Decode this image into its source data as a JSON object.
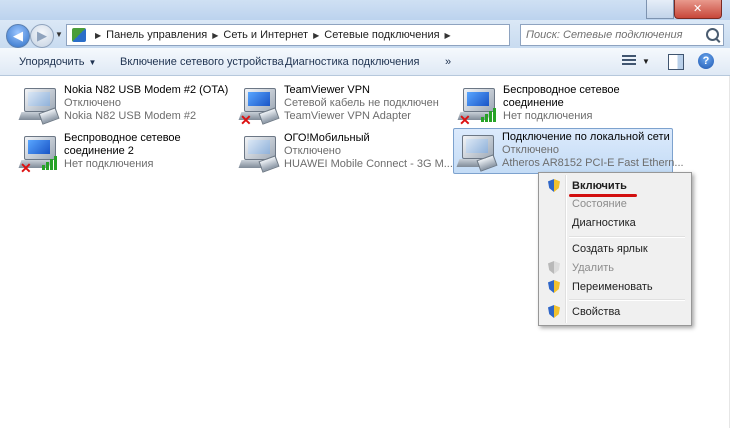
{
  "address": {
    "breadcrumbs": [
      "Панель управления",
      "Сеть и Интернет",
      "Сетевые подключения"
    ],
    "search_placeholder": "Поиск: Сетевые подключения"
  },
  "toolbar": {
    "organize": "Упорядочить",
    "enable_device": "Включение сетевого устройства",
    "diagnose": "Диагностика подключения",
    "more": "»"
  },
  "connections": [
    {
      "name": "Nokia N82 USB Modem #2 (OTA)",
      "status": "Отключено",
      "device": "Nokia N82 USB Modem #2",
      "icon": "modem-icon"
    },
    {
      "name": "TeamViewer VPN",
      "status": "Сетевой кабель не подключен",
      "device": "TeamViewer VPN Adapter",
      "icon": "network-cable-icon"
    },
    {
      "name": "Беспроводное сетевое",
      "name2": "соединение",
      "status": "Нет подключения",
      "icon": "wireless-icon"
    },
    {
      "name": "Беспроводное сетевое",
      "name2": "соединение 2",
      "status": "Нет подключения",
      "icon": "wireless-icon"
    },
    {
      "name": "ОГО!Мобильный",
      "status": "Отключено",
      "device": "HUAWEI Mobile Connect - 3G M...",
      "icon": "modem-icon"
    },
    {
      "name": "Подключение по локальной сети",
      "status": "Отключено",
      "device": "Atheros AR8152 PCI-E Fast Ethern...",
      "icon": "network-cable-icon"
    }
  ],
  "context_menu": {
    "enable": "Включить",
    "status": "Состояние",
    "diagnose": "Диагностика",
    "shortcut": "Создать ярлык",
    "delete": "Удалить",
    "rename": "Переименовать",
    "properties": "Свойства"
  },
  "colors": {
    "underline": "#d20f0f",
    "selection": "#c4dcf6"
  }
}
